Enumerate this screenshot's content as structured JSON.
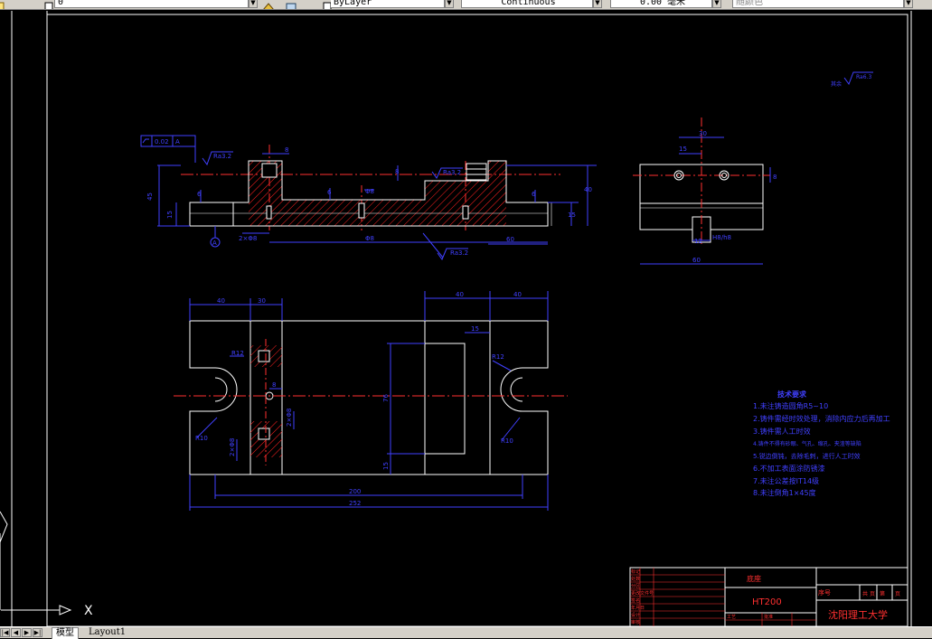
{
  "toolbar": {
    "layer_value": "0",
    "color_value": "ByLayer",
    "linetype_value": "Continuous",
    "lineweight_value": "0.00 毫米",
    "plotstyle_value": "随颜色"
  },
  "tabs": {
    "model": "模型",
    "layout1": "Layout1"
  },
  "ucs": {
    "x_label": "X"
  },
  "colors": {
    "background": "#000000",
    "geometry": "#ffffff",
    "dimension": "#4040ff",
    "centerline": "#ff3030",
    "hatch": "#ff2020"
  },
  "drawing": {
    "front_view": {
      "flatness_tol": "0.02",
      "flatness_datum": "A",
      "roughness_1": "Ra3.2",
      "roughness_2": "Ra3.2",
      "roughness_3": "Ra3.2",
      "datum_marker": "A",
      "dims": {
        "d1": "6",
        "d2": "45",
        "d3": "15",
        "d4": "8",
        "d5": "2×Φ8",
        "d6": "Φ8",
        "d7": "Φ8",
        "d8": "6",
        "d9": "8",
        "d10": "36",
        "d11": "40",
        "d12": "15",
        "d13": "60",
        "d14": "8",
        "d15": "6"
      }
    },
    "side_view": {
      "dims": {
        "s1": "30",
        "s2": "15",
        "s3": "8",
        "s4": "12",
        "s5": "60"
      },
      "fit": "H8/h8"
    },
    "top_view": {
      "dims": {
        "t1": "40",
        "t2": "30",
        "t3": "40",
        "t4": "40",
        "t5": "15",
        "r1": "R12",
        "r2": "R12",
        "r3": "R10",
        "r4": "R10",
        "t6": "8",
        "t7": "2×Φ8",
        "t8": "2×Φ8",
        "t9": "76",
        "t10": "15",
        "t11": "200",
        "t12": "252"
      }
    },
    "overall_roughness": {
      "label": "其余",
      "value": "Ra6.3"
    }
  },
  "notes": {
    "title": "技术要求",
    "items": [
      "1.未注铸造圆角R5~10",
      "2.铸件需经时效处理，消除内应力后再加工",
      "3.铸件需人工时效",
      "4.铸件不得有砂眼、气孔、缩孔、夹渣等缺陷",
      "5.锐边倒钝，去除毛刺，进行人工时效",
      "6.不加工表面涂防锈漆",
      "7.未注公差按IT14级",
      "8.未注倒角1×45度"
    ]
  },
  "title_block": {
    "part_name": "底座",
    "material": "HT200",
    "school": "沈阳理工大学",
    "header_cells": [
      "序号",
      "共",
      "页",
      "第",
      "页"
    ],
    "row_labels": [
      "标记",
      "处数",
      "分区",
      "更改文件号",
      "签名",
      "年月日",
      "设计",
      "审核",
      "工艺",
      "批准"
    ]
  }
}
